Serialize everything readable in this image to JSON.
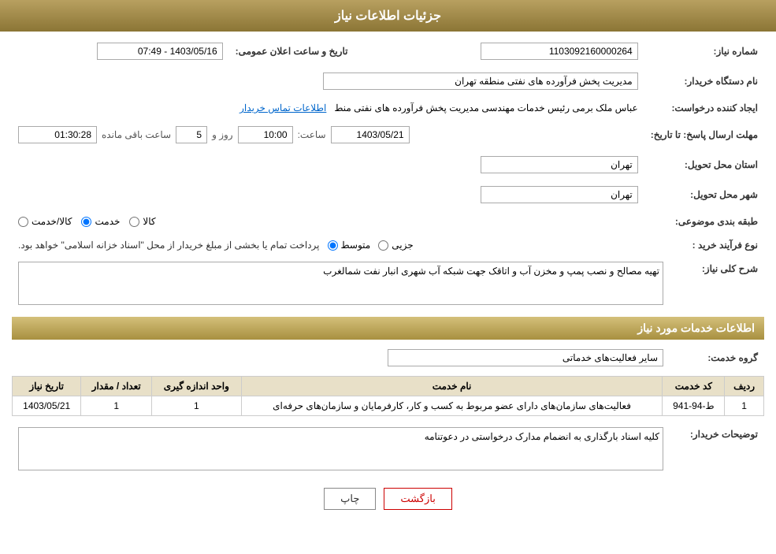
{
  "page": {
    "title": "جزئیات اطلاعات نیاز"
  },
  "header": {
    "announcement_label": "تاریخ و ساعت اعلان عمومی:",
    "announcement_value": "1403/05/16 - 07:49",
    "need_number_label": "شماره نیاز:",
    "need_number_value": "1103092160000264",
    "buyer_org_label": "نام دستگاه خریدار:",
    "buyer_org_value": "مدیریت پخش فرآورده های نفتی منطقه تهران",
    "requester_label": "ایجاد کننده درخواست:",
    "requester_value": "عباس ملک برمی رئیس خدمات مهندسی مدیریت پخش فرآورده های نفتی منط",
    "requester_link": "اطلاعات تماس خریدار",
    "deadline_label": "مهلت ارسال پاسخ: تا تاریخ:",
    "deadline_date": "1403/05/21",
    "deadline_time_label": "ساعت:",
    "deadline_time": "10:00",
    "deadline_days_label": "روز و",
    "deadline_days": "5",
    "deadline_remaining_label": "ساعت باقی مانده",
    "deadline_remaining": "01:30:28",
    "province_label": "استان محل تحویل:",
    "province_value": "تهران",
    "city_label": "شهر محل تحویل:",
    "city_value": "تهران",
    "category_label": "طبقه بندی موضوعی:",
    "category_kala": "کالا",
    "category_khadamat": "خدمت",
    "category_kala_khadamat": "کالا/خدمت",
    "category_selected": "khadamat",
    "purchase_type_label": "نوع فرآیند خرید :",
    "purchase_jozvi": "جزیی",
    "purchase_motavasset": "متوسط",
    "purchase_text": "پرداخت تمام یا بخشی از مبلغ خریدار از محل \"اسناد خزانه اسلامی\" خواهد بود.",
    "purchase_selected": "motavasset"
  },
  "need_description": {
    "section_title": "شرح کلی نیاز:",
    "value": "تهیه مصالح و نصب پمپ و مخزن آب و اتاقک جهت شبکه آب شهری انبار نفت شمالغرب"
  },
  "services_section": {
    "title": "اطلاعات خدمات مورد نیاز",
    "service_group_label": "گروه خدمت:",
    "service_group_value": "سایر فعالیت‌های خدماتی",
    "table_headers": {
      "row_num": "ردیف",
      "service_code": "کد خدمت",
      "service_name": "نام خدمت",
      "unit": "واحد اندازه گیری",
      "quantity": "تعداد / مقدار",
      "date": "تاریخ نیاز"
    },
    "table_rows": [
      {
        "row_num": "1",
        "service_code": "ط-94-941",
        "service_name": "فعالیت‌های سازمان‌های دارای عضو مربوط به کسب و کار، کارفرمایان و سازمان‌های حرفه‌ای",
        "unit": "1",
        "quantity": "1",
        "date": "1403/05/21"
      }
    ]
  },
  "buyer_notes": {
    "label": "توضیحات خریدار:",
    "value": "کلیه اسناد بارگذاری به انضمام مدارک درخواستی در دعوتنامه"
  },
  "buttons": {
    "print": "چاپ",
    "back": "بازگشت"
  }
}
